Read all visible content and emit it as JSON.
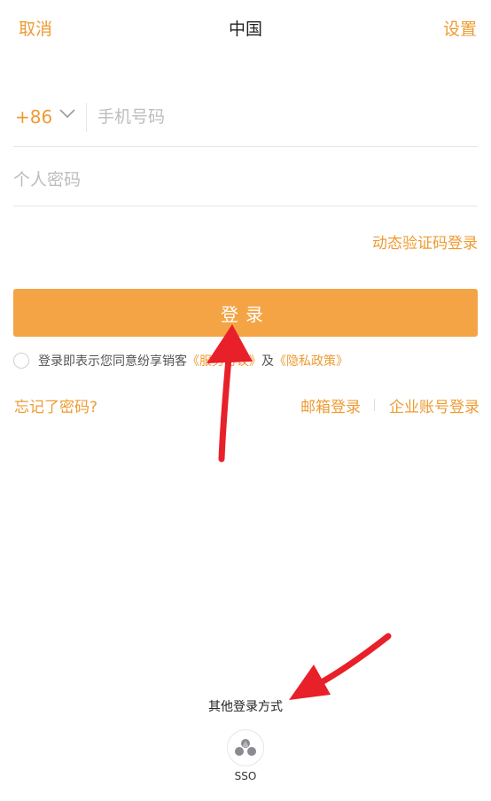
{
  "header": {
    "cancel_label": "取消",
    "title": "中国",
    "settings_label": "设置"
  },
  "phone": {
    "country_code": "+86",
    "placeholder": "手机号码",
    "value": ""
  },
  "password": {
    "placeholder": "个人密码",
    "value": ""
  },
  "links": {
    "sms_login": "动态验证码登录",
    "forgot": "忘记了密码?",
    "email_login": "邮箱登录",
    "corp_login": "企业账号登录"
  },
  "login_button": {
    "label": "登录"
  },
  "agreement": {
    "prefix": "登录即表示您同意纷享销客",
    "service": "《服务协议》",
    "and": "及",
    "privacy": "《隐私政策》"
  },
  "other_login": {
    "label": "其他登录方式",
    "sso_label": "SSO"
  },
  "colors": {
    "accent": "#EE9B33",
    "button": "#F4A444",
    "annotation_arrow": "#E8202A"
  }
}
